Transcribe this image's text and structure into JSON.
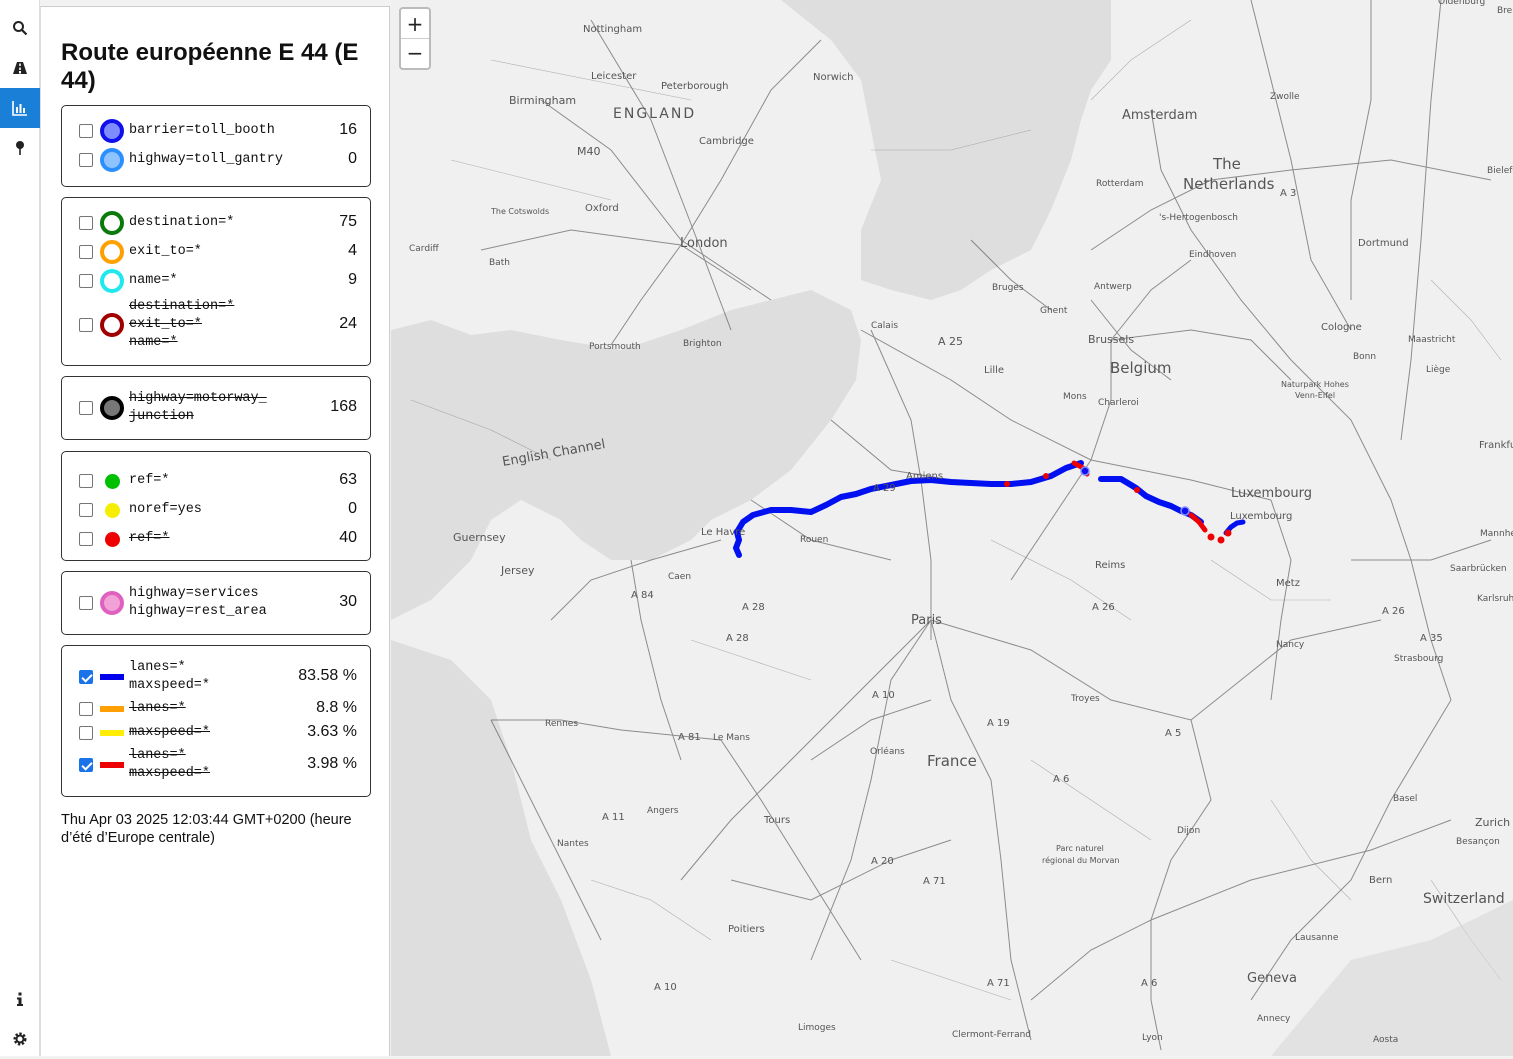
{
  "sidebar_icons": [
    {
      "name": "search-icon"
    },
    {
      "name": "road-icon"
    },
    {
      "name": "chart-icon"
    },
    {
      "name": "pin-icon"
    }
  ],
  "sidebar_bottom_icons": [
    {
      "name": "info-icon"
    },
    {
      "name": "settings-icon"
    }
  ],
  "panel": {
    "title": "Route européenne E 44 (E 44)",
    "groups": [
      {
        "rows": [
          {
            "label": "barrier=toll_booth",
            "count": "16",
            "symbol": "ring",
            "color": "#1010ee",
            "fill": "#7f8cff",
            "strike": false,
            "checked": false
          },
          {
            "label": "highway=toll_gantry",
            "count": "0",
            "symbol": "ring",
            "color": "#2b8fff",
            "fill": "#8fc3ff",
            "strike": false,
            "checked": false
          }
        ]
      },
      {
        "rows": [
          {
            "label": "destination=*",
            "count": "75",
            "symbol": "ring",
            "color": "#0a7a0a",
            "fill": "#ffffff",
            "strike": false,
            "checked": false
          },
          {
            "label": "exit_to=*",
            "count": "4",
            "symbol": "ring",
            "color": "#ffa000",
            "fill": "#ffffff",
            "strike": false,
            "checked": false
          },
          {
            "label": "name=*",
            "count": "9",
            "symbol": "ring",
            "color": "#20e8ee",
            "fill": "#ffffff",
            "strike": false,
            "checked": false
          },
          {
            "label": "destination=*\nexit_to=*\nname=*",
            "count": "24",
            "symbol": "ring",
            "color": "#a00000",
            "fill": "#ffffff",
            "strike": true,
            "checked": false
          }
        ]
      },
      {
        "rows": [
          {
            "label": "highway=motorway_\njunction",
            "count": "168",
            "symbol": "ring",
            "color": "#000000",
            "fill": "#777777",
            "strike": true,
            "checked": false
          }
        ]
      },
      {
        "rows": [
          {
            "label": "ref=*",
            "count": "63",
            "symbol": "dot",
            "color": "#00c000",
            "strike": false,
            "checked": false
          },
          {
            "label": "noref=yes",
            "count": "0",
            "symbol": "dot",
            "color": "#f5ee00",
            "strike": false,
            "checked": false
          },
          {
            "label": "ref=*",
            "count": "40",
            "symbol": "dot",
            "color": "#ee0000",
            "strike": true,
            "checked": false
          }
        ]
      },
      {
        "rows": [
          {
            "label": "highway=services\nhighway=rest_area",
            "count": "30",
            "symbol": "ring",
            "color": "#e060c0",
            "fill": "#f2a0d8",
            "strike": false,
            "checked": false
          }
        ]
      },
      {
        "rows": [
          {
            "label": "lanes=*\nmaxspeed=*",
            "count": "83.58 %",
            "symbol": "bar",
            "color": "#0000ee",
            "strike": false,
            "checked": true
          },
          {
            "label": "lanes=*",
            "count": "8.8 %",
            "symbol": "bar",
            "color": "#ffa000",
            "strike": true,
            "checked": false
          },
          {
            "label": "maxspeed=*",
            "count": "3.63 %",
            "symbol": "bar",
            "color": "#ffee00",
            "strike": true,
            "checked": false
          },
          {
            "label": "lanes=*\nmaxspeed=*",
            "count": "3.98 %",
            "symbol": "bar",
            "color": "#ee0000",
            "strike": true,
            "checked": true
          }
        ]
      }
    ],
    "timestamp": "Thu Apr 03 2025 12:03:44 GMT+0200 (heure d’été d’Europe centrale)"
  },
  "zoom": {
    "in": "+",
    "out": "−"
  },
  "map": {
    "labels": [
      {
        "text": "Nottingham"
      },
      {
        "text": "Leicester"
      },
      {
        "text": "Peterborough"
      },
      {
        "text": "Norwich"
      },
      {
        "text": "Birmingham"
      },
      {
        "text": "ENGLAND"
      },
      {
        "text": "M40"
      },
      {
        "text": "Cambridge"
      },
      {
        "text": "The Cotswolds"
      },
      {
        "text": "Oxford"
      },
      {
        "text": "London"
      },
      {
        "text": "Cardiff"
      },
      {
        "text": "Bath"
      },
      {
        "text": "Portsmouth"
      },
      {
        "text": "Brighton"
      },
      {
        "text": "English Channel"
      },
      {
        "text": "Guernsey"
      },
      {
        "text": "Jersey"
      },
      {
        "text": "Calais"
      },
      {
        "text": "Bruges"
      },
      {
        "text": "Ghent"
      },
      {
        "text": "Antwerp"
      },
      {
        "text": "Brussels"
      },
      {
        "text": "Belgium"
      },
      {
        "text": "Lille"
      },
      {
        "text": "Mons"
      },
      {
        "text": "Charleroi"
      },
      {
        "text": "A 25"
      },
      {
        "text": "Amsterdam"
      },
      {
        "text": "Rotterdam"
      },
      {
        "text": "The"
      },
      {
        "text": "Netherlands"
      },
      {
        "text": "'s-Hertogenbosch"
      },
      {
        "text": "Eindhoven"
      },
      {
        "text": "Zwolle"
      },
      {
        "text": "A 3"
      },
      {
        "text": "Dortmund"
      },
      {
        "text": "Bielefeld"
      },
      {
        "text": "Cologne"
      },
      {
        "text": "Bonn"
      },
      {
        "text": "Maastricht"
      },
      {
        "text": "Liège"
      },
      {
        "text": "Naturpark Hohes"
      },
      {
        "text": "Venn-Eifel"
      },
      {
        "text": "Frankfurt"
      },
      {
        "text": "Luxembourg"
      },
      {
        "text": "Luxembourg"
      },
      {
        "text": "Mannheim"
      },
      {
        "text": "Saarbrücken"
      },
      {
        "text": "Metz"
      },
      {
        "text": "Karlsruhe"
      },
      {
        "text": "Le Havre"
      },
      {
        "text": "Rouen"
      },
      {
        "text": "Amiens"
      },
      {
        "text": "A 29"
      },
      {
        "text": "A 26"
      },
      {
        "text": "Reims"
      },
      {
        "text": "Caen"
      },
      {
        "text": "A 84"
      },
      {
        "text": "A 28"
      },
      {
        "text": "A 28"
      },
      {
        "text": "Paris"
      },
      {
        "text": "A 26"
      },
      {
        "text": "Nancy"
      },
      {
        "text": "A 35"
      },
      {
        "text": "Strasbourg"
      },
      {
        "text": "A 10"
      },
      {
        "text": "Troyes"
      },
      {
        "text": "Rennes"
      },
      {
        "text": "A 19"
      },
      {
        "text": "A 5"
      },
      {
        "text": "A 81"
      },
      {
        "text": "Le Mans"
      },
      {
        "text": "Orléans"
      },
      {
        "text": "France"
      },
      {
        "text": "A 6"
      },
      {
        "text": "A 11"
      },
      {
        "text": "Angers"
      },
      {
        "text": "Tours"
      },
      {
        "text": "Basel"
      },
      {
        "text": "Zurich"
      },
      {
        "text": "Dijon"
      },
      {
        "text": "Besançon"
      },
      {
        "text": "Nantes"
      },
      {
        "text": "Parc naturel"
      },
      {
        "text": "régional du Morvan"
      },
      {
        "text": "A 20"
      },
      {
        "text": "A 71"
      },
      {
        "text": "Bern"
      },
      {
        "text": "Switzerland"
      },
      {
        "text": "Poitiers"
      },
      {
        "text": "Lausanne"
      },
      {
        "text": "A 10"
      },
      {
        "text": "A 71"
      },
      {
        "text": "A 6"
      },
      {
        "text": "Geneva"
      },
      {
        "text": "Annecy"
      },
      {
        "text": "Limoges"
      },
      {
        "text": "Clermont-Ferrand"
      },
      {
        "text": "Lyon"
      },
      {
        "text": "Aosta"
      },
      {
        "text": "Oldenburg"
      },
      {
        "text": "Bre"
      }
    ]
  }
}
